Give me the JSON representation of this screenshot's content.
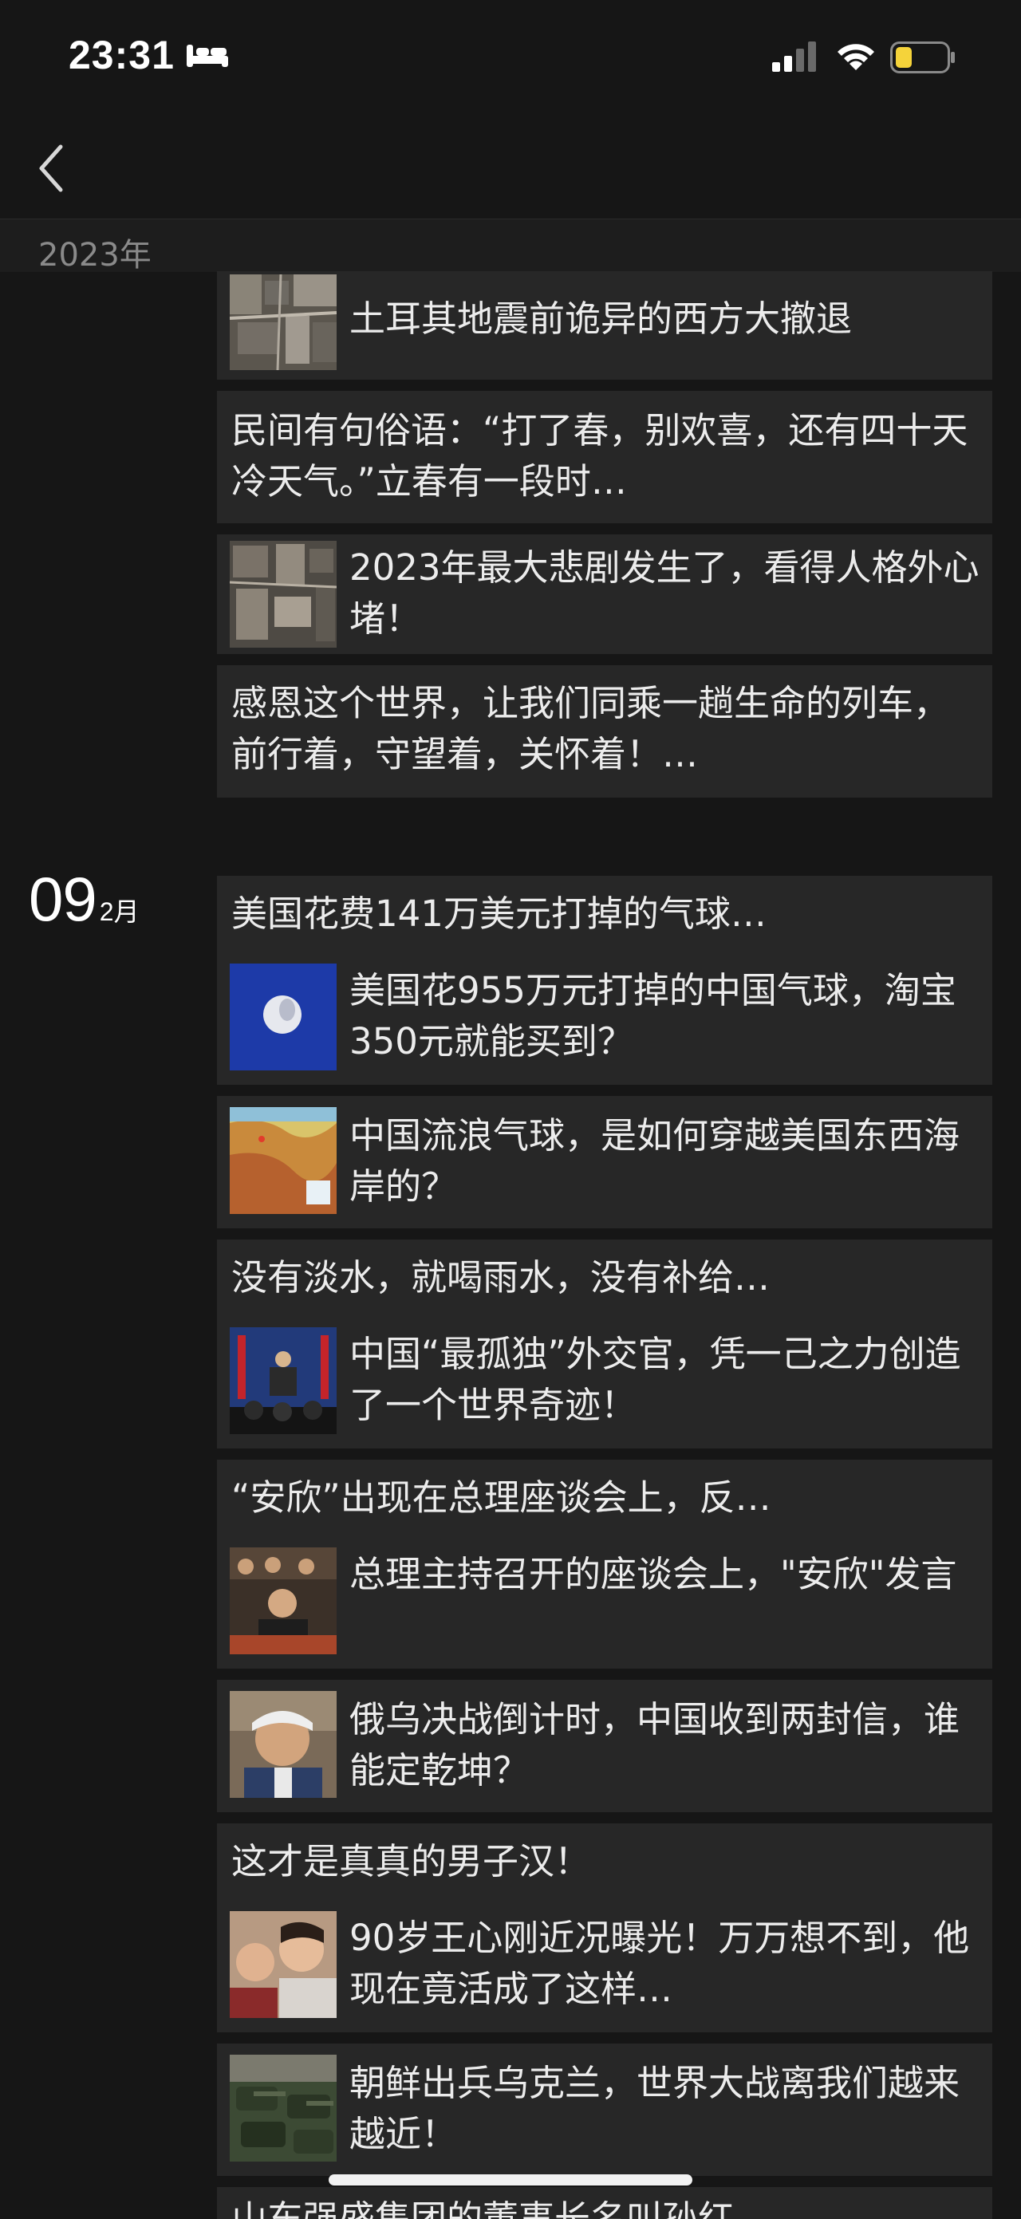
{
  "status_bar": {
    "time": "23:31"
  },
  "year_header": "2023年",
  "groups": [
    {
      "date": null,
      "cards": [
        {
          "title": "土耳其地震前诡异的西方大撤退",
          "thumb": "aerial-city"
        },
        {
          "text": "民间有句俗语：“打了春，别欢喜，还有四十天冷天气。”立春有一段时…"
        },
        {
          "title": "2023年最大悲剧发生了，看得人格外心堵！",
          "thumb": "aerial-ruins"
        },
        {
          "text": "感恩这个世界，让我们同乘一趟生命的列车，前行着，守望着，关怀着！…"
        }
      ]
    },
    {
      "date": {
        "day": "09",
        "month": "2月"
      },
      "cards": [
        {
          "caption": "美国花费141万美元打掉的气球…",
          "title": "美国花955万元打掉的中国气球，淘宝350元就能买到？",
          "thumb": "balloon"
        },
        {
          "title": "中国流浪气球，是如何穿越美国东西海岸的？",
          "thumb": "map"
        },
        {
          "caption": "没有淡水，就喝雨水，没有补给…",
          "title": "中国“最孤独”外交官，凭一己之力创造了一个世界奇迹！",
          "thumb": "press-conference"
        },
        {
          "caption": "“安欣”出现在总理座谈会上，反…",
          "title": "总理主持召开的座谈会上，\"安欣\"发言",
          "thumb": "meeting"
        },
        {
          "title": "俄乌决战倒计时，中国收到两封信，谁能定乾坤？",
          "thumb": "portrait"
        },
        {
          "caption": "这才是真真的男子汉！",
          "title": "90岁王心刚近况曝光！万万想不到，他现在竟活成了这样…",
          "thumb": "couple"
        },
        {
          "title": "朝鲜出兵乌克兰，世界大战离我们越来越近！",
          "thumb": "military"
        },
        {
          "text": "山东强盛集团的董事长名叫孙红…"
        }
      ]
    }
  ],
  "thumb_icons": [
    "aerial-city-icon",
    "aerial-ruins-icon",
    "balloon-icon",
    "map-icon",
    "press-conference-icon",
    "meeting-icon",
    "portrait-icon",
    "couple-icon",
    "military-icon"
  ],
  "colors": {
    "background": "#161616",
    "card": "#272727",
    "text": "#ececec",
    "muted": "#8a8a8a"
  }
}
